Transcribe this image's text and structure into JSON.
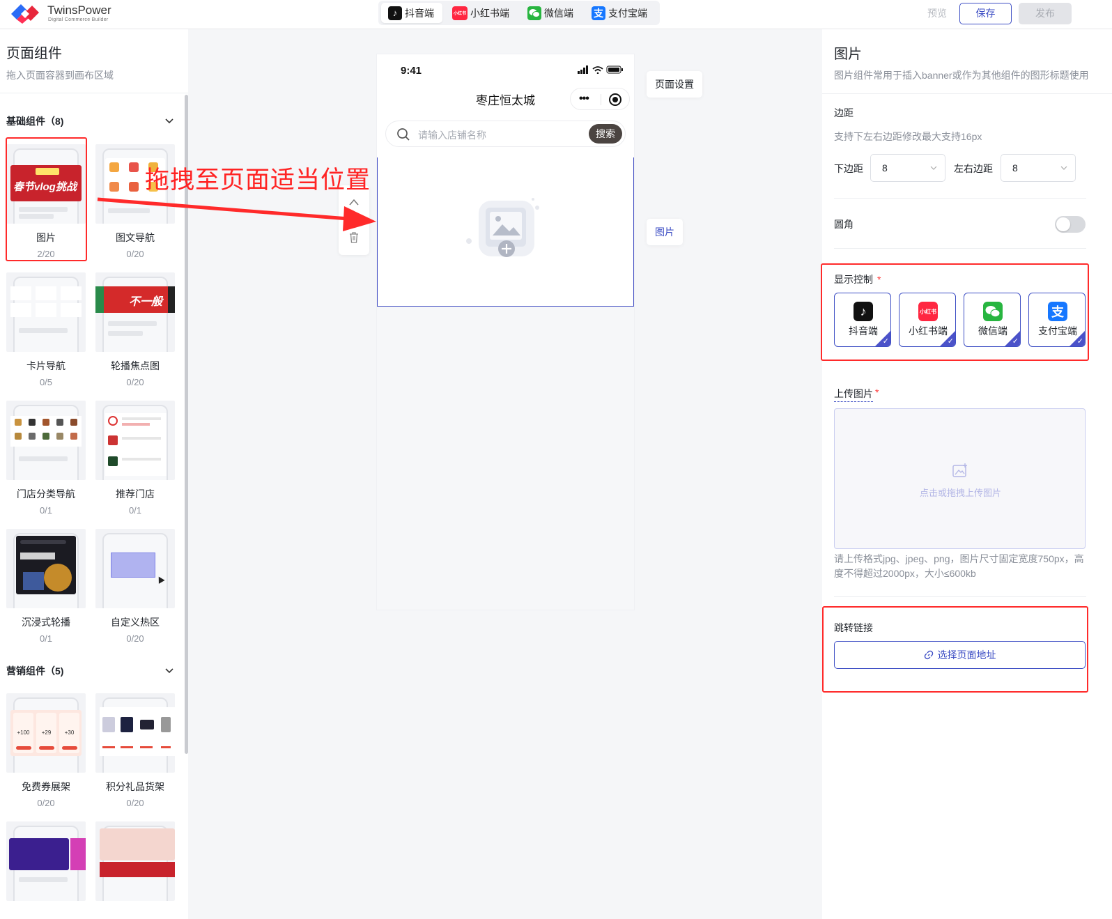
{
  "app": {
    "brand_name": "TwinsPower",
    "brand_tagline": "Digital Commerce Builder"
  },
  "platform_tabs": [
    {
      "label": "抖音端",
      "icon": "tiktok-icon",
      "active": true
    },
    {
      "label": "小红书端",
      "icon": "xiaohongshu-icon",
      "icon_text": "小红书",
      "active": false
    },
    {
      "label": "微信端",
      "icon": "wechat-icon",
      "active": false
    },
    {
      "label": "支付宝端",
      "icon": "alipay-icon",
      "active": false
    }
  ],
  "toolbar": {
    "preview_label": "预览",
    "save_label": "保存",
    "publish_label": "发布"
  },
  "left_panel": {
    "title": "页面组件",
    "subtitle": "拖入页面容器到画布区域",
    "groups": [
      {
        "title": "基础组件（8)",
        "items": [
          {
            "name": "图片",
            "count": "2/20",
            "selected": true
          },
          {
            "name": "图文导航",
            "count": "0/20"
          },
          {
            "name": "卡片导航",
            "count": "0/5"
          },
          {
            "name": "轮播焦点图",
            "count": "0/20"
          },
          {
            "name": "门店分类导航",
            "count": "0/1"
          },
          {
            "name": "推荐门店",
            "count": "0/1"
          },
          {
            "name": "沉浸式轮播",
            "count": "0/1"
          },
          {
            "name": "自定义热区",
            "count": "0/20"
          }
        ]
      },
      {
        "title": "营销组件（5)",
        "items": [
          {
            "name": "免费券展架",
            "count": "0/20"
          },
          {
            "name": "积分礼品货架",
            "count": "0/20"
          }
        ]
      }
    ]
  },
  "annotation": {
    "drag_hint": "拖拽至页面适当位置"
  },
  "thumbnails": {
    "image_banner_text": "春节vlog挑战",
    "carousel_banner_text": "不一般",
    "coupon_values": [
      "+100",
      "+29",
      "+30"
    ]
  },
  "canvas": {
    "status_time": "9:41",
    "nav_title": "枣庄恒太城",
    "search_placeholder": "请输入店铺名称",
    "search_button": "搜索",
    "page_settings_tag": "页面设置",
    "image_tag": "图片"
  },
  "right_panel": {
    "title": "图片",
    "description": "图片组件常用于插入banner或作为其他组件的图形标题使用",
    "margin": {
      "label": "边距",
      "note": "支持下左右边距修改最大支持16px",
      "bottom_label": "下边距",
      "bottom_value": "8",
      "lr_label": "左右边距",
      "lr_value": "8"
    },
    "radius_label": "圆角",
    "radius_on": false,
    "display_control": {
      "label": "显示控制",
      "required_mark": "*",
      "options": [
        {
          "label": "抖音端",
          "icon": "tiktok-icon",
          "checked": true
        },
        {
          "label": "小红书端",
          "icon": "xiaohongshu-icon",
          "icon_text": "小红书",
          "checked": true
        },
        {
          "label": "微信端",
          "icon": "wechat-icon",
          "checked": true
        },
        {
          "label": "支付宝端",
          "icon": "alipay-icon",
          "checked": true
        }
      ]
    },
    "upload": {
      "label": "上传图片",
      "required_mark": "*",
      "placeholder": "点击或拖拽上传图片",
      "note": "请上传格式jpg、jpeg、png，图片尺寸固定宽度750px，高度不得超过2000px，大小≤600kb"
    },
    "link": {
      "label": "跳转链接",
      "button_label": "选择页面地址"
    }
  },
  "colors": {
    "accent": "#3d4ec4",
    "annotation_red": "#ff2a2a",
    "tiktok": "#111111",
    "xiaohongshu": "#ff2741",
    "wechat": "#28b540",
    "alipay": "#1677ff"
  }
}
